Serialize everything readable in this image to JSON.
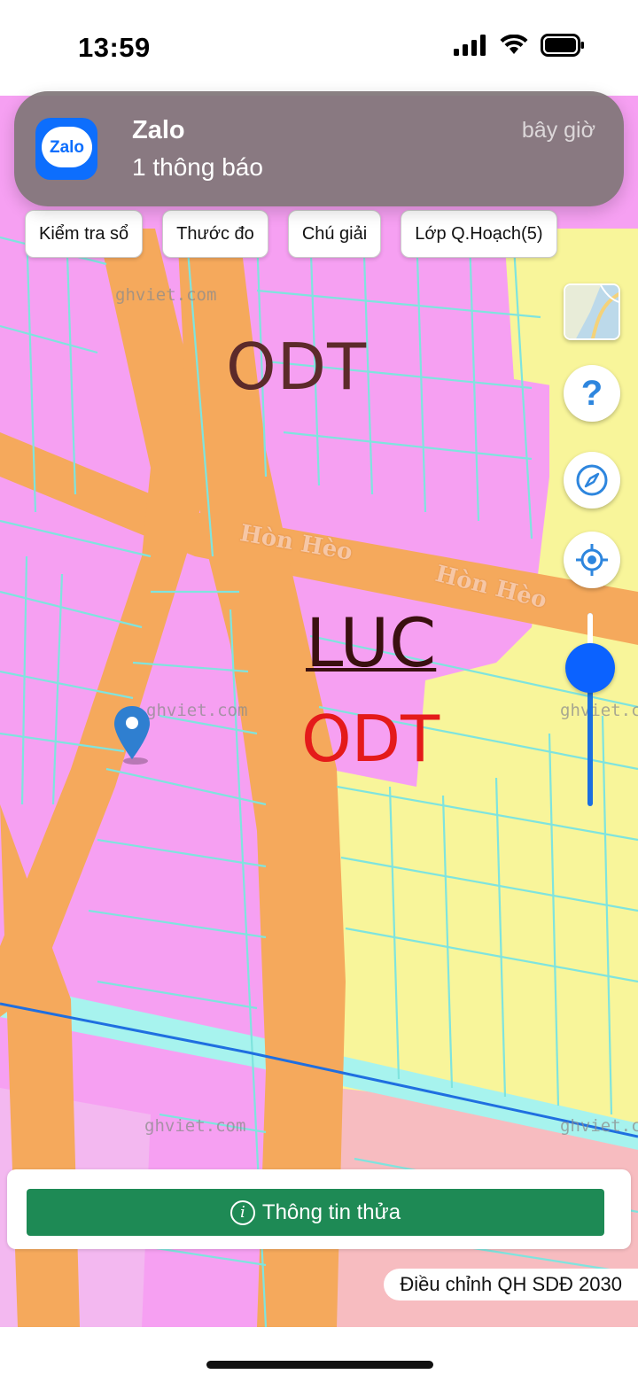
{
  "status_bar": {
    "time": "13:59",
    "icons": [
      "cellular-signal-icon",
      "wifi-icon",
      "battery-icon"
    ]
  },
  "notification": {
    "app_name": "Zalo",
    "icon_text": "Zalo",
    "time": "bây giờ",
    "body": "1 thông báo"
  },
  "toolbar": {
    "buttons": [
      "Kiểm tra sổ",
      "Thước đo",
      "Chú giải",
      "Lớp Q.Hoạch(5)"
    ]
  },
  "map": {
    "zone_labels": [
      "ODT",
      "LUC",
      "ODT"
    ],
    "street_labels": [
      "Hòn Hèo",
      "Hòn Hèo"
    ],
    "watermark": "ghviet.com",
    "colors": {
      "residential": "#f6a0f2",
      "agricultural": "#f8f59a",
      "road": "#f5a95c",
      "water": "#a7f3ee",
      "parcel_lines": "#7fe4de",
      "river_line": "#1f6fe0",
      "other_zone": "#f7c0c2"
    }
  },
  "controls": {
    "help_label": "?",
    "icons": [
      "basemap-thumbnail",
      "help-icon",
      "compass-icon",
      "locate-icon",
      "zoom-slider"
    ]
  },
  "info_panel": {
    "button_label": "Thông tin thửa",
    "icon_glyph": "i"
  },
  "plan_badge": "Điều chỉnh QH SDĐ 2030"
}
